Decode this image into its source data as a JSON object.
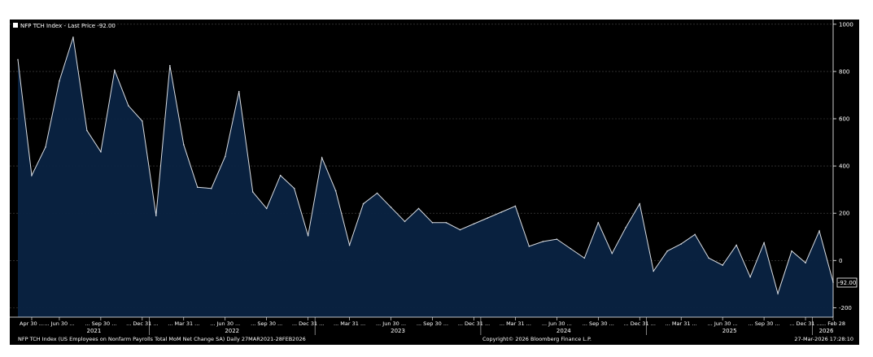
{
  "chart_data": {
    "type": "area",
    "legend_label": "NFP TCH Index - Last Price -92.00",
    "last_value_label": "-92.00",
    "footer_left": "NFP TCH Index (US Employees on Nonfarm Payrolls Total MoM Net Change SA) Daily 27MAR2021-28FEB2026",
    "footer_center": "Copyright© 2026 Bloomberg Finance L.P.",
    "footer_right": "27-Mar-2026 17:28:10",
    "ylim": [
      -240,
      1020
    ],
    "yticks": [
      1000,
      800,
      600,
      400,
      200,
      0,
      -200
    ],
    "grid": true,
    "legend_position": "top-left",
    "colors": {
      "line": "#d9dde3",
      "fill": "#0a2342",
      "background": "#000000",
      "grid": "#4a4a4a"
    },
    "x_tick_labels": [
      "Apr 30 ...",
      "... Jun 30 ...",
      "... Sep 30 ...",
      "... Dec 31 ...",
      "... Mar 31 ...",
      "... Jun 30 ...",
      "... Sep 30 ...",
      "... Dec 31 ...",
      "... Mar 31 ...",
      "... Jun 30 ...",
      "... Sep 30 ...",
      "... Dec 31 ...",
      "... Mar 31 ...",
      "... Jun 30 ...",
      "... Sep 30 ...",
      "... Dec 31 ...",
      "... Mar 31 ...",
      "... Jun 30 ...",
      "... Sep 30 ...",
      "... Dec 31 ...",
      "... Feb 28"
    ],
    "x_year_labels": [
      "2021",
      "2022",
      "2023",
      "2024",
      "2025",
      "2026"
    ],
    "series": [
      {
        "x": [
          "2021-03",
          "2021-04",
          "2021-05",
          "2021-06",
          "2021-07",
          "2021-08",
          "2021-09",
          "2021-10",
          "2021-11",
          "2021-12",
          "2022-01",
          "2022-02",
          "2022-03",
          "2022-04",
          "2022-05",
          "2022-06",
          "2022-07",
          "2022-08",
          "2022-09",
          "2022-10",
          "2022-11",
          "2022-12",
          "2023-01",
          "2023-02",
          "2023-03",
          "2023-04",
          "2023-05",
          "2023-06",
          "2023-07",
          "2023-08",
          "2023-09",
          "2023-10",
          "2023-11",
          "2023-12",
          "2024-01",
          "2024-02",
          "2024-03",
          "2024-04",
          "2024-05",
          "2024-06",
          "2024-07",
          "2024-08",
          "2024-09",
          "2024-10",
          "2024-11",
          "2024-12",
          "2025-01",
          "2025-02",
          "2025-03",
          "2025-04",
          "2025-05",
          "2025-06",
          "2025-07",
          "2025-08",
          "2025-09",
          "2025-10",
          "2025-11",
          "2025-12",
          "2026-01",
          "2026-02"
        ],
        "values": [
          850,
          360,
          480,
          760,
          945,
          550,
          460,
          805,
          655,
          590,
          190,
          825,
          490,
          310,
          305,
          440,
          715,
          290,
          220,
          360,
          305,
          105,
          435,
          295,
          65,
          240,
          285,
          225,
          165,
          220,
          160,
          160,
          130,
          155,
          180,
          205,
          230,
          60,
          80,
          90,
          50,
          10,
          160,
          30,
          140,
          240,
          -45,
          40,
          70,
          110,
          10,
          -20,
          65,
          -70,
          75,
          -140,
          40,
          -10,
          125,
          -92
        ]
      }
    ]
  }
}
